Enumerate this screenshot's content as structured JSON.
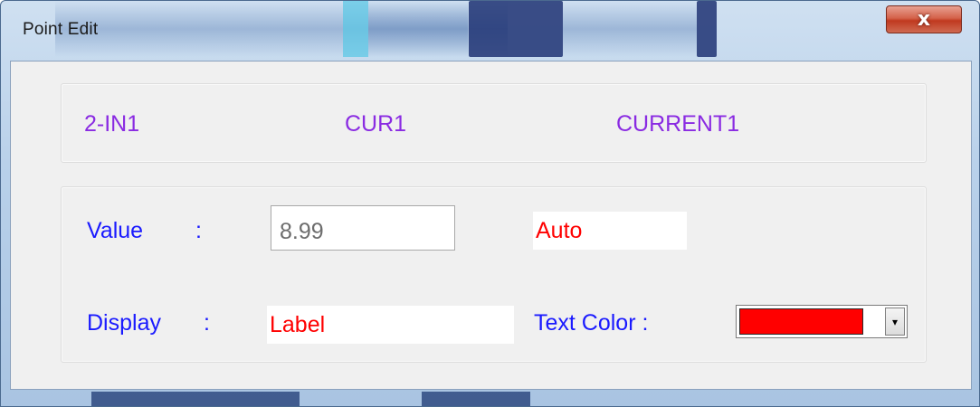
{
  "window": {
    "title": "Point Edit",
    "close_label": "x"
  },
  "header": {
    "item1": "2-IN1",
    "item2": "CUR1",
    "item3": "CURRENT1"
  },
  "form": {
    "value_label": "Value",
    "value_colon": ":",
    "value_input": "8.99",
    "mode": "Auto",
    "display_label": "Display",
    "display_colon": ":",
    "display_value": "Label",
    "text_color_label": "Text Color :",
    "text_color_value": "#ff0000",
    "dropdown_icon": "▾"
  },
  "colors": {
    "header_text": "#8a2be2",
    "label_text": "#1a1aff",
    "value_text": "#ff0000"
  }
}
